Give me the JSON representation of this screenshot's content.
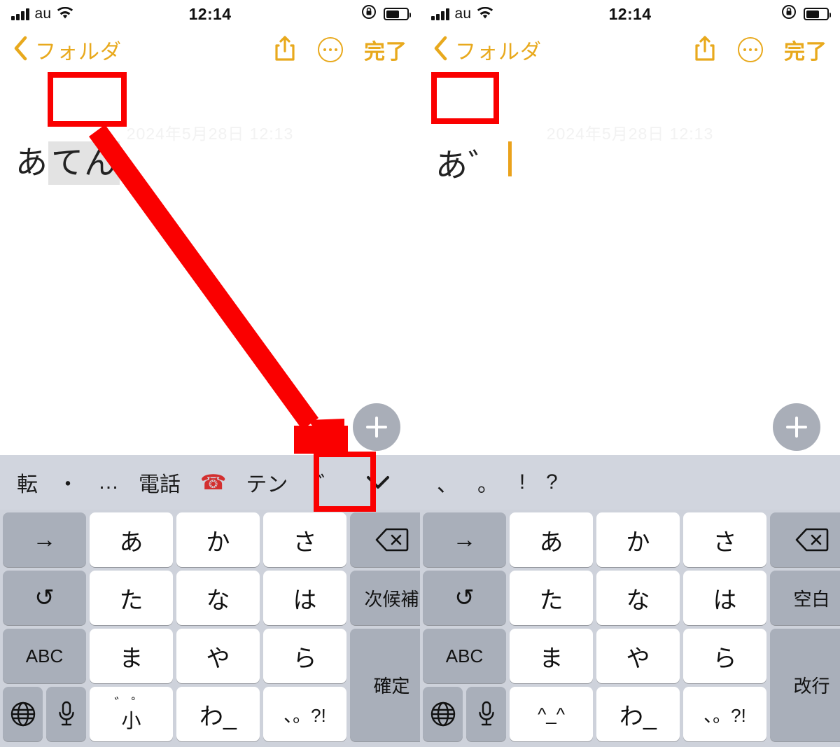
{
  "status_bar": {
    "carrier": "au",
    "time": "12:14",
    "signal_icon": "cellular-bars-icon",
    "wifi_icon": "wifi-icon",
    "rotation_lock_icon": "rotation-lock-icon",
    "battery_icon": "battery-icon"
  },
  "nav_bar": {
    "back_icon": "chevron-left-icon",
    "back_label": "フォルダ",
    "share_icon": "share-icon",
    "more_icon": "ellipsis-circle-icon",
    "done_label": "完了"
  },
  "note": {
    "date_watermark": "2024年5月28日 12:13",
    "left_text_plain": "あ",
    "left_text_marked": "てん",
    "right_text": "あ゛",
    "caret_color": "#eaa21c",
    "add_button_icon": "plus-icon"
  },
  "keyboard": {
    "left_suggestions": [
      {
        "label": "転",
        "type": "text"
      },
      {
        "label": "・",
        "type": "text"
      },
      {
        "label": "…",
        "type": "text"
      },
      {
        "label": "電話",
        "type": "text"
      },
      {
        "label": "☎",
        "type": "emoji"
      },
      {
        "label": "テン",
        "type": "text"
      },
      {
        "label": "゛",
        "type": "dakuten"
      }
    ],
    "right_suggestions": [
      {
        "label": "、",
        "type": "text"
      },
      {
        "label": "。",
        "type": "text"
      },
      {
        "label": "!",
        "type": "text"
      },
      {
        "label": "?",
        "type": "text"
      }
    ],
    "expand_icon": "chevron-down-icon",
    "left_keys": {
      "row1": [
        "→",
        "あ",
        "か",
        "さ",
        "delete-icon"
      ],
      "row2": [
        "↺",
        "た",
        "な",
        "は",
        "次候補"
      ],
      "row3": [
        "ABC",
        "ま",
        "や",
        "ら",
        "確定"
      ],
      "row4_globe": "globe-icon",
      "row4_mic": "microphone-icon",
      "row4": [
        "゛゜小",
        "わ_",
        "、。?!"
      ]
    },
    "right_keys": {
      "row1": [
        "→",
        "あ",
        "か",
        "さ",
        "delete-icon"
      ],
      "row2": [
        "↺",
        "た",
        "な",
        "は",
        "空白"
      ],
      "row3": [
        "ABC",
        "ま",
        "や",
        "ら",
        "改行"
      ],
      "row4_globe": "globe-icon",
      "row4_mic": "microphone-icon",
      "row4": [
        "^_^",
        "わ_",
        "、。?!"
      ]
    },
    "dakuten_small_key": {
      "top": "゛゜",
      "bottom": "小"
    }
  },
  "annotations": {
    "highlight_color": "#fa0000",
    "boxes": [
      {
        "name": "left-marked-text-box"
      },
      {
        "name": "right-composed-text-box"
      },
      {
        "name": "dakuten-suggestion-box"
      }
    ],
    "arrow": {
      "name": "instruction-arrow",
      "from": "left-marked-text-box",
      "to": "dakuten-suggestion-box"
    }
  },
  "colors": {
    "accent": "#e8a91d",
    "keyboard_bg": "#ced2db",
    "suggestion_bg": "#d1d5de",
    "function_key": "#a9afba",
    "letter_key": "#ffffff",
    "annotation_red": "#fa0000"
  }
}
